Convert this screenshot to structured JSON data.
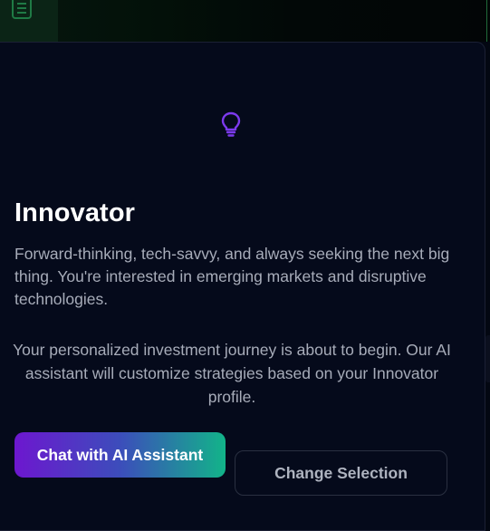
{
  "colors": {
    "background": "#030712",
    "modal": "#050a1b",
    "accent_purple": "#6d17cf",
    "accent_green": "#12b489",
    "bulb_icon": "#7c3aed"
  },
  "header": {
    "icon": "document-icon"
  },
  "modal": {
    "icon": "lightbulb-icon",
    "title": "Innovator",
    "description": "Forward-thinking, tech-savvy, and always seeking the next big thing. You're interested in emerging markets and disruptive technologies.",
    "journey_text": "Your personalized investment journey is about to begin. Our AI assistant will customize strategies based on your Innovator profile.",
    "primary_button": "Chat with AI Assistant",
    "secondary_button": "Change Selection"
  }
}
